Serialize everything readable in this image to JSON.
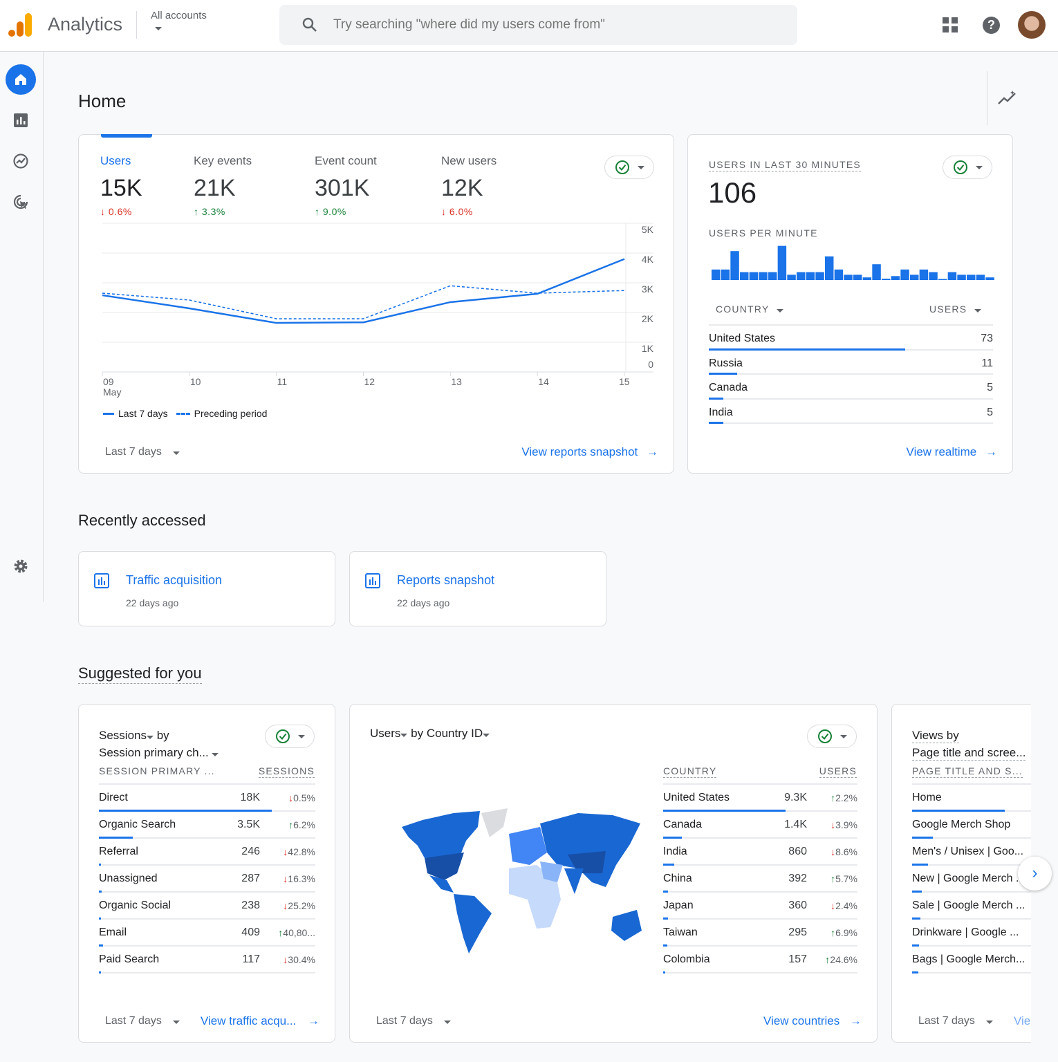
{
  "header": {
    "app_name": "Analytics",
    "account_label": "All accounts",
    "search_placeholder": "Try searching \"where did my users come from\""
  },
  "page_title": "Home",
  "overview": {
    "metrics": [
      {
        "label": "Users",
        "value": "15K",
        "delta": "0.6%",
        "direction": "down",
        "selected": true
      },
      {
        "label": "Key events",
        "value": "21K",
        "delta": "3.3%",
        "direction": "up"
      },
      {
        "label": "Event count",
        "value": "301K",
        "delta": "9.0%",
        "direction": "up"
      },
      {
        "label": "New users",
        "value": "12K",
        "delta": "6.0%",
        "direction": "down"
      }
    ],
    "date_range": "Last 7 days",
    "link": "View reports snapshot"
  },
  "chart_data": {
    "type": "line",
    "categories": [
      "09 May",
      "10",
      "11",
      "12",
      "13",
      "14",
      "15"
    ],
    "x_tick_labels": [
      "09",
      "10",
      "11",
      "12",
      "13",
      "14",
      "15"
    ],
    "x_sub_label": "May",
    "y_tick_labels": [
      "5K",
      "4K",
      "3K",
      "2K",
      "1K",
      "0"
    ],
    "ylim": [
      0,
      5000
    ],
    "grid": true,
    "legend_position": "bottom-left",
    "series": [
      {
        "name": "Last 7 days",
        "style": "solid",
        "values": [
          2580,
          2140,
          1650,
          1670,
          2350,
          2630,
          3800
        ]
      },
      {
        "name": "Preceding period",
        "style": "dashed",
        "values": [
          2650,
          2420,
          1790,
          1790,
          2900,
          2650,
          2740
        ]
      }
    ],
    "color": "#1a73e8"
  },
  "realtime": {
    "title": "USERS IN LAST 30 MINUTES",
    "value": "106",
    "per_minute_label": "USERS PER MINUTE",
    "per_minute": [
      4,
      4,
      11,
      3,
      3,
      3,
      3,
      13,
      2,
      3,
      3,
      3,
      9,
      4,
      2,
      2,
      1,
      6,
      0.5,
      1.5,
      4,
      2,
      4,
      3,
      0.3,
      3,
      2,
      2,
      2,
      1
    ],
    "col_country": "COUNTRY",
    "col_users": "USERS",
    "rows": [
      {
        "name": "United States",
        "value": "73",
        "share": 0.69
      },
      {
        "name": "Russia",
        "value": "11",
        "share": 0.1
      },
      {
        "name": "Canada",
        "value": "5",
        "share": 0.05
      },
      {
        "name": "India",
        "value": "5",
        "share": 0.05
      }
    ],
    "link": "View realtime"
  },
  "recent": {
    "title": "Recently accessed",
    "items": [
      {
        "title": "Traffic acquisition",
        "sub": "22 days ago"
      },
      {
        "title": "Reports snapshot",
        "sub": "22 days ago"
      }
    ]
  },
  "suggested": {
    "title": "Suggested for you",
    "sessions": {
      "title_metric": "Sessions",
      "title_by": "by",
      "title_dim": "Session primary ch...",
      "col_dim": "SESSION PRIMARY ...",
      "col_metric": "SESSIONS",
      "rows": [
        {
          "name": "Direct",
          "value": "18K",
          "delta": "0.5%",
          "direction": "down",
          "share": 0.8
        },
        {
          "name": "Organic Search",
          "value": "3.5K",
          "delta": "6.2%",
          "direction": "up",
          "share": 0.155
        },
        {
          "name": "Referral",
          "value": "246",
          "delta": "42.8%",
          "direction": "down",
          "share": 0.011
        },
        {
          "name": "Unassigned",
          "value": "287",
          "delta": "16.3%",
          "direction": "down",
          "share": 0.013
        },
        {
          "name": "Organic Social",
          "value": "238",
          "delta": "25.2%",
          "direction": "down",
          "share": 0.011
        },
        {
          "name": "Email",
          "value": "409",
          "delta": "40,80...",
          "direction": "up",
          "share": 0.018
        },
        {
          "name": "Paid Search",
          "value": "117",
          "delta": "30.4%",
          "direction": "down",
          "share": 0.005
        }
      ],
      "date_range": "Last 7 days",
      "link": "View traffic acqu..."
    },
    "countries": {
      "title_metric": "Users",
      "title_by": "by",
      "title_dim": "Country ID",
      "col_dim": "COUNTRY",
      "col_metric": "USERS",
      "rows": [
        {
          "name": "United States",
          "value": "9.3K",
          "delta": "2.2%",
          "direction": "up",
          "share": 0.63
        },
        {
          "name": "Canada",
          "value": "1.4K",
          "delta": "3.9%",
          "direction": "down",
          "share": 0.095
        },
        {
          "name": "India",
          "value": "860",
          "delta": "8.6%",
          "direction": "down",
          "share": 0.058
        },
        {
          "name": "China",
          "value": "392",
          "delta": "5.7%",
          "direction": "up",
          "share": 0.026
        },
        {
          "name": "Japan",
          "value": "360",
          "delta": "2.4%",
          "direction": "down",
          "share": 0.024
        },
        {
          "name": "Taiwan",
          "value": "295",
          "delta": "6.9%",
          "direction": "up",
          "share": 0.02
        },
        {
          "name": "Colombia",
          "value": "157",
          "delta": "24.6%",
          "direction": "up",
          "share": 0.011
        }
      ],
      "date_range": "Last 7 days",
      "link": "View countries"
    },
    "views": {
      "title_line1": "Views by",
      "title_dim": "Page title and scree...",
      "col_dim": "PAGE TITLE AND S...",
      "rows": [
        {
          "name": "Home",
          "share": 0.58
        },
        {
          "name": "Google Merch Shop",
          "share": 0.13
        },
        {
          "name": "Men's / Unisex | Goo...",
          "share": 0.1
        },
        {
          "name": "New | Google Merch ...",
          "share": 0.06
        },
        {
          "name": "Sale | Google Merch ...",
          "share": 0.05
        },
        {
          "name": "Drinkware | Google ...",
          "share": 0.045
        },
        {
          "name": "Bags | Google Merch...",
          "share": 0.04
        }
      ],
      "date_range": "Last 7 days",
      "link": "Vie"
    }
  },
  "colors": {
    "accent": "#1a73e8",
    "down": "#d93025",
    "up": "#188038",
    "logo_orange": "#e37400",
    "logo_yellow": "#f9ab00"
  }
}
